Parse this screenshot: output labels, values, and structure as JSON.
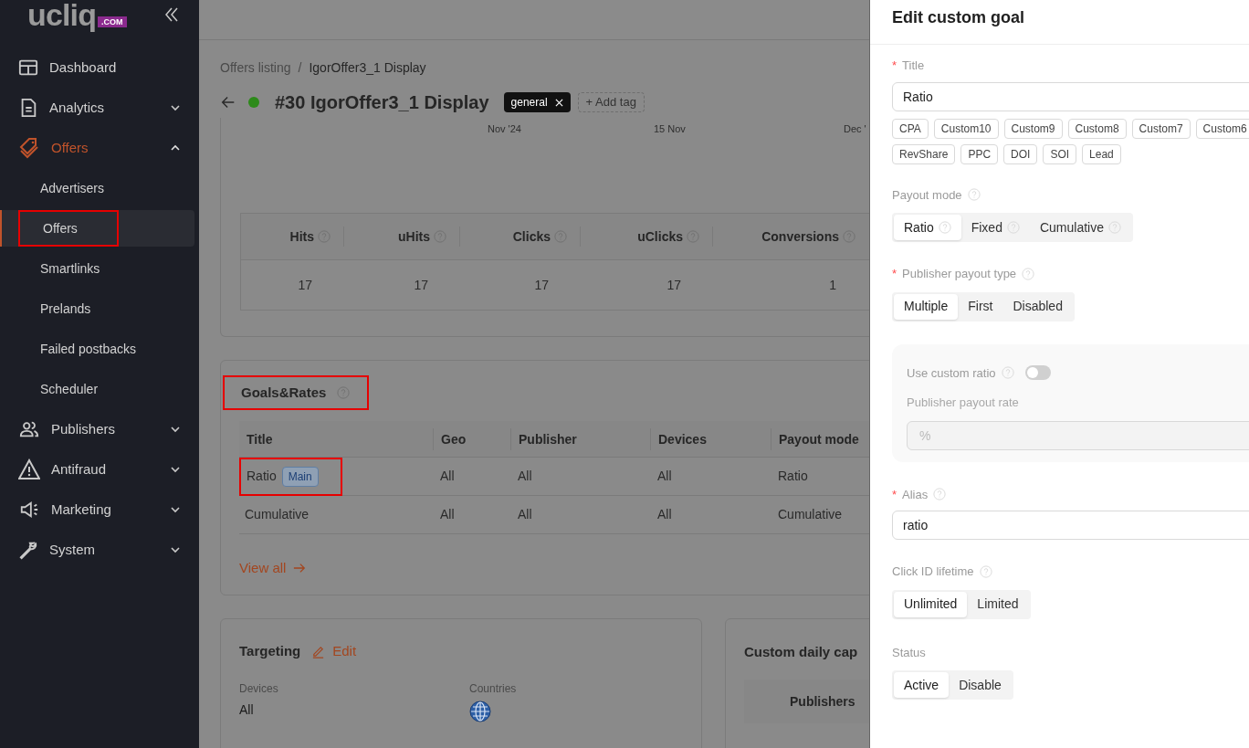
{
  "sidebar": {
    "logo": {
      "text": "ucliq",
      "suffix": ".COM"
    },
    "items": [
      {
        "label": "Dashboard",
        "kind": "link",
        "active": false
      },
      {
        "label": "Analytics",
        "kind": "group",
        "expanded": false,
        "active": false
      },
      {
        "label": "Offers",
        "kind": "group",
        "expanded": true,
        "active": true,
        "children": [
          {
            "label": "Advertisers",
            "selected": false,
            "highlighted": false
          },
          {
            "label": "Offers",
            "selected": true,
            "highlighted": true
          },
          {
            "label": "Smartlinks",
            "selected": false,
            "highlighted": false
          },
          {
            "label": "Prelands",
            "selected": false,
            "highlighted": false
          },
          {
            "label": "Failed postbacks",
            "selected": false,
            "highlighted": false
          },
          {
            "label": "Scheduler",
            "selected": false,
            "highlighted": false
          }
        ]
      },
      {
        "label": "Publishers",
        "kind": "group",
        "expanded": false,
        "active": false
      },
      {
        "label": "Antifraud",
        "kind": "group",
        "expanded": false,
        "active": false
      },
      {
        "label": "Marketing",
        "kind": "group",
        "expanded": false,
        "active": false
      },
      {
        "label": "System",
        "kind": "group",
        "expanded": false,
        "active": false
      }
    ]
  },
  "breadcrumb": {
    "items": [
      "Offers listing",
      "IgorOffer3_1 Display"
    ],
    "separator": "/"
  },
  "offer": {
    "title": "#30 IgorOffer3_1 Display",
    "tags": [
      "general"
    ],
    "add_tag": "+ Add tag"
  },
  "timeline_labels": [
    "Nov '24",
    "15 Nov",
    "Dec '"
  ],
  "stats": {
    "columns": [
      "Hits",
      "uHits",
      "Clicks",
      "uClicks",
      "Conversions"
    ],
    "values": [
      "17",
      "17",
      "17",
      "17",
      "1"
    ]
  },
  "goals": {
    "title": "Goals&Rates",
    "highlighted": true,
    "columns": [
      "Title",
      "Geo",
      "Publisher",
      "Devices",
      "Payout mode"
    ],
    "rows": [
      {
        "cells": [
          "Ratio",
          "All",
          "All",
          "All",
          "Ratio"
        ],
        "badge": "Main",
        "highlighted": true
      },
      {
        "cells": [
          "Cumulative",
          "All",
          "All",
          "All",
          "Cumulative"
        ],
        "highlighted": false
      }
    ],
    "view_all": "View all"
  },
  "targeting": {
    "title": "Targeting",
    "edit": "Edit",
    "fields": [
      {
        "label": "Devices",
        "kind": "text",
        "value": "All"
      },
      {
        "label": "Countries",
        "kind": "globe"
      }
    ]
  },
  "daily_cap": {
    "title": "Custom daily cap",
    "columns": [
      "Publishers"
    ]
  },
  "drawer": {
    "title": "Edit custom goal",
    "required_mark": "*",
    "fields": [
      {
        "kind": "text",
        "label": "Title",
        "required": true,
        "help": false,
        "value": "Ratio",
        "suggestions": [
          "CPA",
          "Custom10",
          "Custom9",
          "Custom8",
          "Custom7",
          "Custom6",
          "RevShare",
          "PPC",
          "DOI",
          "SOI",
          "Lead"
        ]
      },
      {
        "kind": "segmented",
        "label": "Payout mode",
        "required": false,
        "help": true,
        "options": [
          {
            "label": "Ratio",
            "help": true,
            "selected": true
          },
          {
            "label": "Fixed",
            "help": true,
            "selected": false
          },
          {
            "label": "Cumulative",
            "help": true,
            "selected": false
          }
        ]
      },
      {
        "kind": "segmented",
        "label": "Publisher payout type",
        "required": true,
        "help": true,
        "options": [
          {
            "label": "Multiple",
            "help": false,
            "selected": true
          },
          {
            "label": "First",
            "help": false,
            "selected": false
          },
          {
            "label": "Disabled",
            "help": false,
            "selected": false
          }
        ]
      },
      {
        "kind": "panel",
        "toggle": {
          "label": "Use custom ratio",
          "help": true,
          "on": false
        },
        "rate": {
          "label": "Publisher payout rate",
          "placeholder": "%",
          "disabled": true
        }
      },
      {
        "kind": "text",
        "label": "Alias",
        "required": true,
        "help": true,
        "value": "ratio"
      },
      {
        "kind": "segmented",
        "label": "Click ID lifetime",
        "required": false,
        "help": true,
        "options": [
          {
            "label": "Unlimited",
            "help": false,
            "selected": true
          },
          {
            "label": "Limited",
            "help": false,
            "selected": false
          }
        ]
      },
      {
        "kind": "segmented",
        "label": "Status",
        "required": false,
        "help": false,
        "options": [
          {
            "label": "Active",
            "help": false,
            "selected": true
          },
          {
            "label": "Disable",
            "help": false,
            "selected": false
          }
        ]
      }
    ]
  }
}
